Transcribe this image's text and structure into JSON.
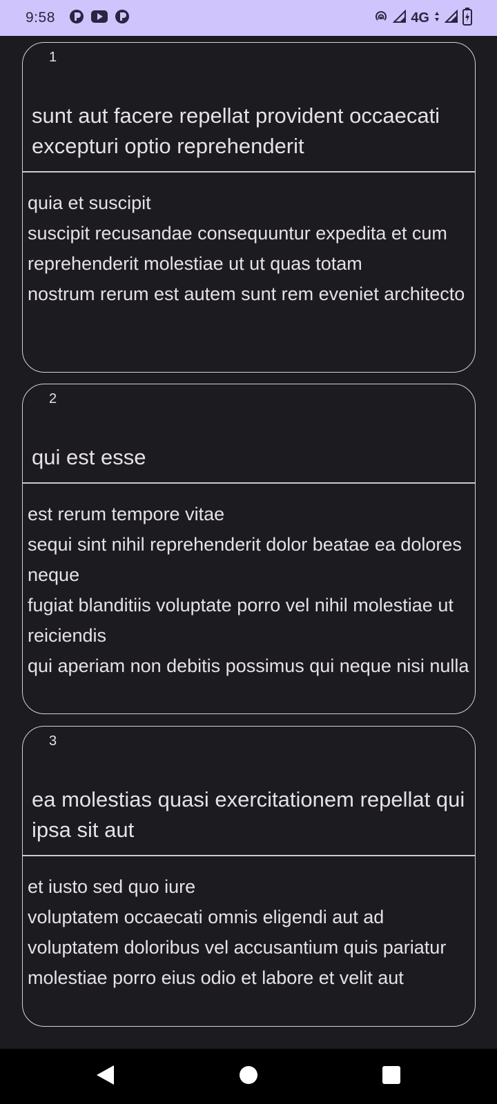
{
  "status_bar": {
    "time": "9:58",
    "network": "4G",
    "left_icons": [
      "app-notification-icon",
      "youtube-icon",
      "app-notification-icon"
    ],
    "right_icons": [
      "hotspot-icon",
      "signal-icon",
      "data-arrows-icon",
      "signal-icon",
      "battery-charging-icon"
    ]
  },
  "posts": [
    {
      "id": "1",
      "title": "sunt aut facere repellat provident occaecati excepturi optio reprehenderit",
      "body": "quia et suscipit\nsuscipit recusandae consequuntur expedita et cum\nreprehenderit molestiae ut ut quas totam\nnostrum rerum est autem sunt rem eveniet architecto"
    },
    {
      "id": "2",
      "title": "qui est esse",
      "body": "est rerum tempore vitae\nsequi sint nihil reprehenderit dolor beatae ea dolores neque\nfugiat blanditiis voluptate porro vel nihil molestiae ut reiciendis\nqui aperiam non debitis possimus qui neque nisi nulla"
    },
    {
      "id": "3",
      "title": "ea molestias quasi exercitationem repellat qui ipsa sit aut",
      "body": "et iusto sed quo iure\nvoluptatem occaecati omnis eligendi aut ad\nvoluptatem doloribus vel accusantium quis pariatur\nmolestiae porro eius odio et labore et velit aut"
    }
  ],
  "nav_bar": {
    "buttons": [
      "back-icon",
      "home-icon",
      "recents-icon"
    ]
  },
  "colors": {
    "background": "#1c1b1f",
    "status_bar": "#cfc4fb",
    "card_border": "#d7d3dc",
    "text": "#e6e1e6"
  }
}
